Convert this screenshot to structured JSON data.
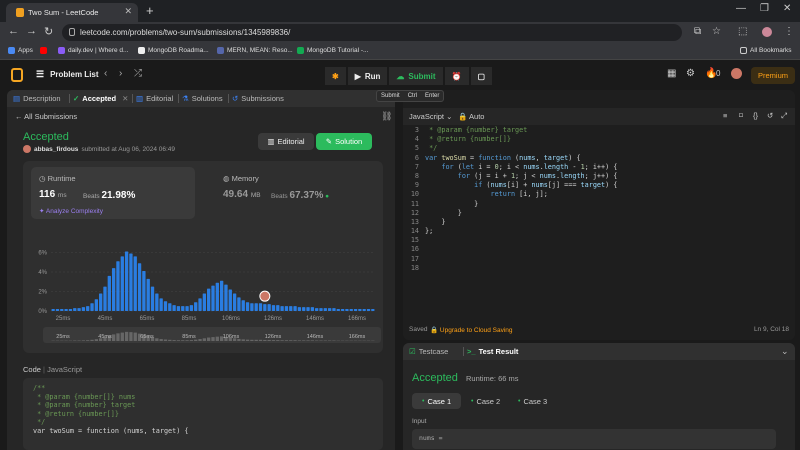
{
  "browser": {
    "tab_title": "Two Sum - LeetCode",
    "url": "leetcode.com/problems/two-sum/submissions/1345989836/",
    "bookmarks": [
      {
        "label": "Apps",
        "color": "#4a8af4"
      },
      {
        "label": "",
        "color": "#ff0000"
      },
      {
        "label": "daily.dev | Where d...",
        "color": "#8a5cf6"
      },
      {
        "label": "MongoDB Roadma...",
        "color": "#222222"
      },
      {
        "label": "MERN, MEAN: Reso...",
        "color": "#5566aa"
      },
      {
        "label": "MongoDB Tutorial -...",
        "color": "#13aa52"
      }
    ],
    "all_bookmarks": "All Bookmarks"
  },
  "lc_nav": {
    "problem_list": "Problem List",
    "run": "Run",
    "submit": "Submit",
    "streak": "0",
    "premium": "Premium"
  },
  "tooltip": {
    "label": "Submit",
    "key1": "Ctrl",
    "key2": "Enter"
  },
  "left_tabs": [
    "Description",
    "Accepted",
    "Editorial",
    "Solutions",
    "Submissions"
  ],
  "submission": {
    "back": "All Submissions",
    "status": "Accepted",
    "user": "abbas_firdous",
    "submitted_text": "submitted at Aug 06, 2024 06:49",
    "editorial_btn": "Editorial",
    "solution_btn": "Solution",
    "runtime_label": "Runtime",
    "runtime_value": "116",
    "runtime_unit": "ms",
    "runtime_beats_label": "Beats",
    "runtime_beats": "21.98%",
    "analyze": "Analyze Complexity",
    "memory_label": "Memory",
    "memory_value": "49.64",
    "memory_unit": "MB",
    "memory_beats_label": "Beats",
    "memory_beats": "67.37%"
  },
  "chart_data": {
    "type": "bar",
    "y_ticks": [
      "6%",
      "4%",
      "2%",
      "0%"
    ],
    "ylim": [
      0,
      8
    ],
    "x_ticks": [
      "25ms",
      "45ms",
      "65ms",
      "85ms",
      "106ms",
      "126ms",
      "146ms",
      "166ms"
    ],
    "values": [
      0.2,
      0.2,
      0.2,
      0.2,
      0.2,
      0.3,
      0.3,
      0.4,
      0.5,
      0.8,
      1.2,
      1.8,
      2.5,
      3.6,
      4.4,
      5.1,
      5.6,
      6.1,
      5.9,
      5.6,
      4.9,
      4.1,
      3.3,
      2.5,
      1.8,
      1.3,
      1.0,
      0.8,
      0.6,
      0.5,
      0.5,
      0.5,
      0.6,
      0.9,
      1.3,
      1.8,
      2.3,
      2.6,
      2.9,
      3.1,
      2.7,
      2.2,
      1.8,
      1.4,
      1.1,
      0.9,
      0.8,
      0.8,
      0.8,
      0.7,
      0.7,
      0.6,
      0.6,
      0.5,
      0.5,
      0.5,
      0.5,
      0.4,
      0.4,
      0.4,
      0.4,
      0.3,
      0.3,
      0.3,
      0.3,
      0.3,
      0.2,
      0.2,
      0.2,
      0.2,
      0.2,
      0.2,
      0.2,
      0.2,
      0.2
    ],
    "marker_index": 49
  },
  "code_label": {
    "title": "Code",
    "lang": "JavaScript"
  },
  "code_preview": [
    "/**",
    " * @param {number[]} nums",
    " * @param {number} target",
    " * @return {number[]}",
    " */",
    "var twoSum = function (nums, target) {"
  ],
  "editor": {
    "language": "JavaScript",
    "mode": "Auto",
    "lines": [
      {
        "n": "3",
        "t": " * @param {number} target"
      },
      {
        "n": "4",
        "t": " * @return {number[]}"
      },
      {
        "n": "5",
        "t": " */"
      },
      {
        "n": "6",
        "t": "var twoSum = function (nums, target) {"
      },
      {
        "n": "7",
        "t": "    for (let i = 0; i < nums.length - 1; i++) {"
      },
      {
        "n": "8",
        "t": "        for (j = i + 1; j < nums.length; j++) {"
      },
      {
        "n": "9",
        "t": "            if (nums[i] + nums[j] === target) {"
      },
      {
        "n": "10",
        "t": "                return [i, j];"
      },
      {
        "n": "11",
        "t": "            }"
      },
      {
        "n": "12",
        "t": "        }"
      },
      {
        "n": "13",
        "t": "    }"
      },
      {
        "n": "14",
        "t": "};"
      },
      {
        "n": "15",
        "t": ""
      },
      {
        "n": "16",
        "t": ""
      },
      {
        "n": "17",
        "t": ""
      },
      {
        "n": "18",
        "t": ""
      }
    ],
    "saved": "Saved",
    "upgrade": "Upgrade to Cloud Saving",
    "position": "Ln 9, Col 18"
  },
  "result": {
    "tab_testcase": "Testcase",
    "tab_result": "Test Result",
    "status": "Accepted",
    "runtime": "Runtime: 66 ms",
    "cases": [
      "Case 1",
      "Case 2",
      "Case 3"
    ],
    "input_label": "Input",
    "input_value": "nums ="
  }
}
